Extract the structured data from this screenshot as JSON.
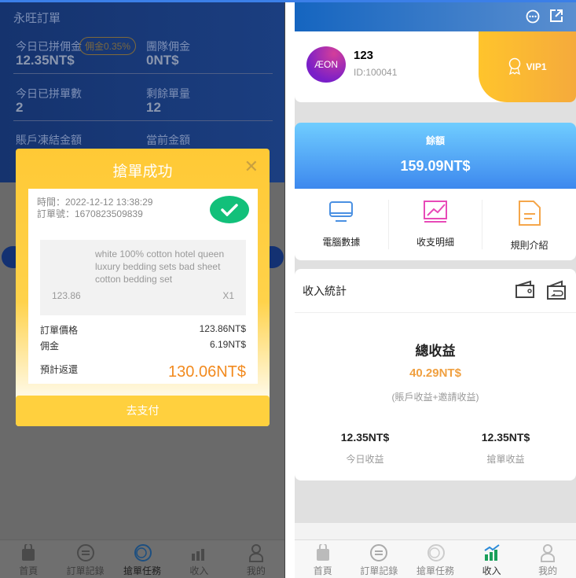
{
  "left": {
    "header_title": "永旺訂單",
    "stats": [
      {
        "label": "今日已拼佣金",
        "value": "12.35NT$",
        "badge": "佣金0.35%"
      },
      {
        "label": "團隊佣金",
        "value": "0NT$"
      },
      {
        "label": "今日已拼單數",
        "value": "2"
      },
      {
        "label": "剩餘單量",
        "value": "12"
      },
      {
        "label": "賬戶凍結金額",
        "value": ""
      },
      {
        "label": "當前金額",
        "value": ""
      }
    ],
    "modal": {
      "title": "搶單成功",
      "time": "時間：2022-12-12 13:38:29",
      "order_no": "訂單號：1670823509839",
      "product_name": "white 100% cotton hotel queen luxury bedding sets bad sheet cotton bedding set",
      "product_price": "123.86",
      "quantity": "X1",
      "order_price_label": "訂單價格",
      "order_price": "123.86NT$",
      "commission_label": "佣金",
      "commission": "6.19NT$",
      "return_label": "預計返還",
      "return_value": "130.06NT$",
      "pay_label": "去支付"
    },
    "nav": [
      {
        "label": "首頁",
        "icon": "bag-icon"
      },
      {
        "label": "訂單記錄",
        "icon": "exchange-icon"
      },
      {
        "label": "搶單任務",
        "icon": "coin-icon",
        "active": true
      },
      {
        "label": "收入",
        "icon": "chart-icon"
      },
      {
        "label": "我的",
        "icon": "user-icon"
      }
    ]
  },
  "right": {
    "user": {
      "name": "123",
      "id": "ID:100041",
      "logo": "ÆON",
      "vip": "VIP1"
    },
    "balance": {
      "label": "餘額",
      "value": "159.09NT$"
    },
    "menu": [
      {
        "label": "電腦數據",
        "icon": "monitor-icon"
      },
      {
        "label": "收支明細",
        "icon": "trend-icon"
      },
      {
        "label": "規則介紹",
        "icon": "document-icon"
      }
    ],
    "income": {
      "title": "收入統計",
      "total_label": "總收益",
      "total": "40.29NT$",
      "note": "(賬戶收益+邀請收益)",
      "today_value": "12.35NT$",
      "today_label": "今日收益",
      "grab_value": "12.35NT$",
      "grab_label": "搶單收益"
    },
    "nav": [
      {
        "label": "首頁"
      },
      {
        "label": "訂單記錄"
      },
      {
        "label": "搶單任務"
      },
      {
        "label": "收入",
        "active": true
      },
      {
        "label": "我的"
      }
    ]
  },
  "colors": {
    "accent_orange": "#f28a1e",
    "success_green": "#12c07a",
    "modal_yellow": "#ffc935",
    "active_nav": "#1a9f5a"
  }
}
